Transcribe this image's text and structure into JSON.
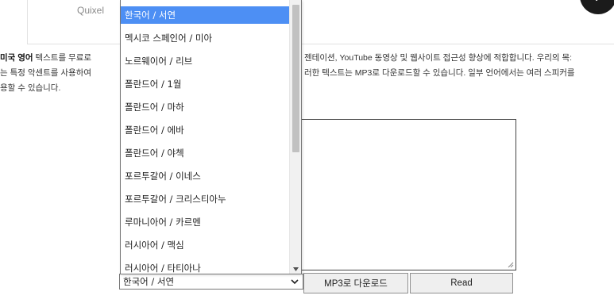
{
  "card": {
    "label": "Quixel"
  },
  "description": {
    "bold": "미국 영어",
    "line1a": " 텍스트를 무료로",
    "line1b": "젠테이션, YouTube 동영상 및 웹사이트 접근성 향상에 적합합니다. 우리의 목:",
    "line2a": "는 특정 악센트를 사용하여",
    "line2b": "러한 텍스트는 MP3로 다운로드할 수 있습니다. 일부 언어에서는 여러 스피커를",
    "line3": "용할 수 있습니다."
  },
  "voice_select": {
    "value": "한국어 / 서연",
    "options": [
      {
        "label": "한국어 / 서연",
        "selected": true
      },
      {
        "label": "멕시코 스페인어 / 미아"
      },
      {
        "label": "노르웨이어 / 리브"
      },
      {
        "label": "폴란드어 / 1월"
      },
      {
        "label": "폴란드어 / 마하"
      },
      {
        "label": "폴란드어 / 에바"
      },
      {
        "label": "폴란드어 / 야첵"
      },
      {
        "label": "포르투갈어 / 이네스"
      },
      {
        "label": "포르투갈어 / 크리스티아누"
      },
      {
        "label": "루마니아어 / 카르멘"
      },
      {
        "label": "러시아어 / 맥심"
      },
      {
        "label": "러시아어 / 타티아나"
      }
    ]
  },
  "text_input": {
    "value": ""
  },
  "buttons": {
    "mp3": "MP3로 다운로드",
    "read": "Read"
  },
  "colors": {
    "selected_option": "#4d8ff4",
    "next_button": "#1b1b1b"
  },
  "icons": {
    "next": "chevron-right-icon",
    "dropdown": "chevron-down-icon",
    "scroll_down": "arrow-down-icon"
  }
}
